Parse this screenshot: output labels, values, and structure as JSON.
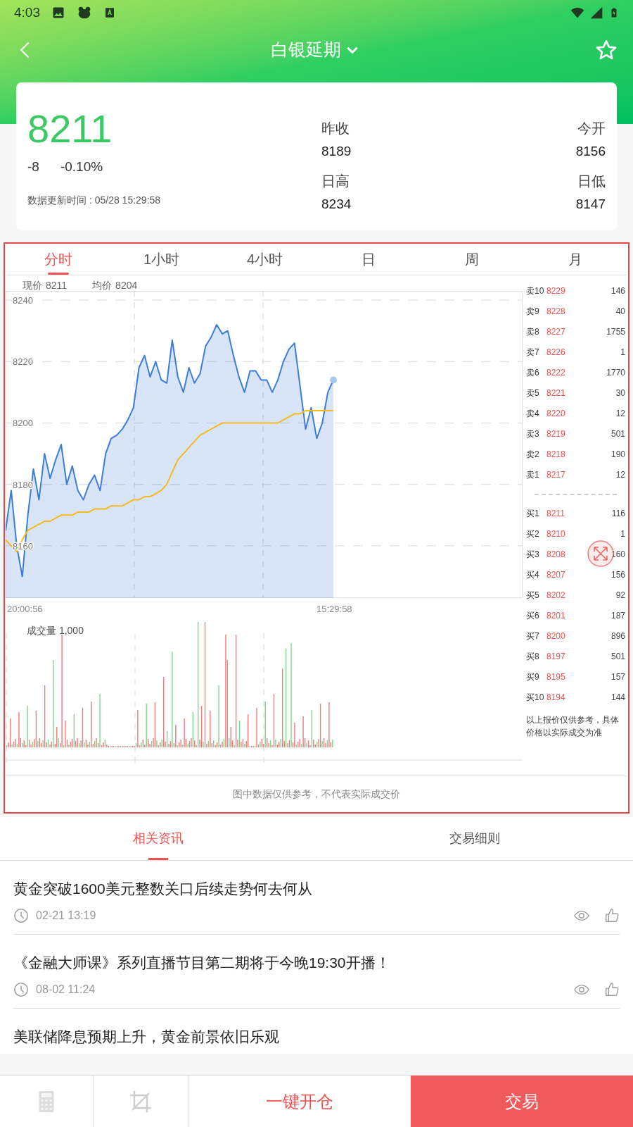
{
  "status_bar": {
    "time": "4:03"
  },
  "header": {
    "title": "白银延期"
  },
  "quote": {
    "price": "8211",
    "change": "-8",
    "change_pct": "-0.10%",
    "updated": "数据更新时间 : 05/28 15:29:58",
    "stats": [
      {
        "label": "昨收",
        "value": "8189"
      },
      {
        "label": "今开",
        "value": "8156"
      },
      {
        "label": "日高",
        "value": "8234"
      },
      {
        "label": "日低",
        "value": "8147"
      }
    ]
  },
  "chart_tabs": [
    {
      "label": "分时",
      "selected": true
    },
    {
      "label": "1小时",
      "selected": false
    },
    {
      "label": "4小时",
      "selected": false
    },
    {
      "label": "日",
      "selected": false
    },
    {
      "label": "周",
      "selected": false
    },
    {
      "label": "月",
      "selected": false
    }
  ],
  "chart_legend": [
    "8211",
    "8204"
  ],
  "price_chart": {
    "chart_data": {
      "type": "line",
      "ylim": [
        8143,
        8243
      ],
      "yticks": [
        8160,
        8180,
        8200,
        8220,
        8240
      ],
      "grid": true,
      "series": [
        {
          "name": "现价",
          "type": "area",
          "color": "#3b7ddd",
          "values": [
            8165,
            8178,
            8160,
            8150,
            8170,
            8185,
            8175,
            8190,
            8182,
            8188,
            8193,
            8180,
            8186,
            8178,
            8175,
            8180,
            8183,
            8178,
            8190,
            8195,
            8196,
            8198,
            8201,
            8205,
            8218,
            8222,
            8215,
            8220,
            8214,
            8213,
            8227,
            8215,
            8210,
            8218,
            8213,
            8216,
            8225,
            8228,
            8232,
            8229,
            8230,
            8222,
            8215,
            8210,
            8217,
            8217,
            8214,
            8214,
            8210,
            8214,
            8220,
            8224,
            8226,
            8212,
            8198,
            8205,
            8195,
            8200,
            8210,
            8214
          ]
        },
        {
          "name": "均价",
          "type": "line",
          "color": "#f5b922",
          "values": [
            8162,
            8160,
            8158,
            8162,
            8165,
            8166,
            8167,
            8168,
            8168,
            8169,
            8170,
            8170,
            8170,
            8171,
            8171,
            8171,
            8172,
            8172,
            8172,
            8173,
            8173,
            8173,
            8174,
            8175,
            8175,
            8176,
            8176,
            8177,
            8178,
            8180,
            8184,
            8188,
            8190,
            8192,
            8194,
            8196,
            8197,
            8198,
            8199,
            8200,
            8200,
            8200,
            8200,
            8200,
            8200,
            8200,
            8200,
            8200,
            8200,
            8200,
            8201,
            8202,
            8203,
            8203,
            8204,
            8204,
            8204,
            8204,
            8204,
            8204
          ]
        }
      ]
    },
    "time_labels": [
      "20:00:56",
      "15:29:58"
    ]
  },
  "volume_chart": {
    "label": "成交量 1,000"
  },
  "order_book": {
    "asks": [
      {
        "label": "卖10",
        "price": "8229",
        "volume": "146"
      },
      {
        "label": "卖9",
        "price": "8228",
        "volume": "40"
      },
      {
        "label": "卖8",
        "price": "8227",
        "volume": "1755"
      },
      {
        "label": "卖7",
        "price": "8226",
        "volume": "1"
      },
      {
        "label": "卖6",
        "price": "8222",
        "volume": "1770"
      },
      {
        "label": "卖5",
        "price": "8221",
        "volume": "30"
      },
      {
        "label": "卖4",
        "price": "8220",
        "volume": "12"
      },
      {
        "label": "卖3",
        "price": "8219",
        "volume": "501"
      },
      {
        "label": "卖2",
        "price": "8218",
        "volume": "190"
      },
      {
        "label": "卖1",
        "price": "8217",
        "volume": "12"
      }
    ],
    "bids": [
      {
        "label": "买1",
        "price": "8211",
        "volume": "116"
      },
      {
        "label": "买2",
        "price": "8210",
        "volume": "1"
      },
      {
        "label": "买3",
        "price": "8208",
        "volume": "160"
      },
      {
        "label": "买4",
        "price": "8207",
        "volume": "156"
      },
      {
        "label": "买5",
        "price": "8202",
        "volume": "92"
      },
      {
        "label": "买6",
        "price": "8201",
        "volume": "187"
      },
      {
        "label": "买7",
        "price": "8200",
        "volume": "896"
      },
      {
        "label": "买8",
        "price": "8197",
        "volume": "501"
      },
      {
        "label": "买9",
        "price": "8195",
        "volume": "157"
      },
      {
        "label": "买10",
        "price": "8194",
        "volume": "144"
      }
    ],
    "note": "以上报价仅供参考，具体价格以实际成交为准"
  },
  "chart_note": "图中数据仅供参考，不代表实际成交价",
  "news_tabs": [
    {
      "label": "相关资讯",
      "selected": true
    },
    {
      "label": "交易细则",
      "selected": false
    }
  ],
  "news": [
    {
      "title": "黄金突破1600美元整数关口后续走势何去何从",
      "time": "02-21 13:19"
    },
    {
      "title": "《金融大师课》系列直播节目第二期将于今晚19:30开播！",
      "time": "08-02 11:24"
    },
    {
      "title": "美联储降息预期上升，黄金前景依旧乐观"
    }
  ],
  "bottom_bar": {
    "open_button": "一键开仓",
    "trade_button": "交易"
  }
}
